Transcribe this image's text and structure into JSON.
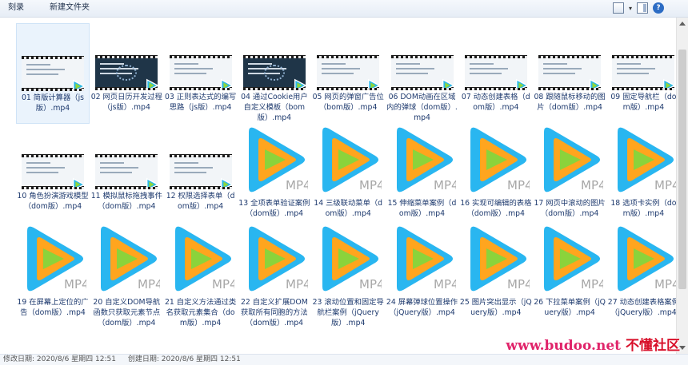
{
  "toolbar": {
    "burn_label": "刻录",
    "new_folder_label": "新建文件夹",
    "dropdown_arrow": "▾",
    "help_glyph": "?"
  },
  "files": [
    {
      "name": "01 简版计算器（js版）.mp4",
      "kind": "video",
      "theme": "light",
      "selected": true
    },
    {
      "name": "02 网页日历开发过程（js版）.mp4",
      "kind": "video",
      "theme": "dark"
    },
    {
      "name": "03 正则表达式的编写思路（js版）.mp4",
      "kind": "video",
      "theme": "light"
    },
    {
      "name": "04 通过Cookie用户自定义模板（bom版）.mp4",
      "kind": "video",
      "theme": "dark"
    },
    {
      "name": "05 网页的弹窗广告位（bom版）.mp4",
      "kind": "video",
      "theme": "light"
    },
    {
      "name": "06 DOM动画在区域内的弹球（dom版）.mp4",
      "kind": "video",
      "theme": "light"
    },
    {
      "name": "07 动态创建表格（dom版）.mp4",
      "kind": "video",
      "theme": "light"
    },
    {
      "name": "08 跟随鼠标移动的图片（dom版）.mp4",
      "kind": "video",
      "theme": "light"
    },
    {
      "name": "09 固定导航栏（dom版）.mp4",
      "kind": "video",
      "theme": "light"
    },
    {
      "name": "10 角色扮演游戏模型（dom版）.mp4",
      "kind": "video",
      "theme": "light"
    },
    {
      "name": "11 模拟鼠标拖拽事件（dom版）.mp4",
      "kind": "video",
      "theme": "light"
    },
    {
      "name": "12 权限选择表单（dom版）.mp4",
      "kind": "video",
      "theme": "light"
    },
    {
      "name": "13 全项表单验证案例（dom版）.mp4",
      "kind": "mp4"
    },
    {
      "name": "14 三级联动菜单（dom版）.mp4",
      "kind": "mp4"
    },
    {
      "name": "15 伸缩菜单案例（dom版）.mp4",
      "kind": "mp4"
    },
    {
      "name": "16 实现可编辑的表格（dom版）.mp4",
      "kind": "mp4"
    },
    {
      "name": "17 网页中滚动的图片（dom版）.mp4",
      "kind": "mp4"
    },
    {
      "name": "18 选项卡实例（dom版）.mp4",
      "kind": "mp4"
    },
    {
      "name": "19 在屏幕上定位的广告（dom版）.mp4",
      "kind": "mp4"
    },
    {
      "name": "20 自定义DOM导航函数只获取元素节点（dom版）.mp4",
      "kind": "mp4"
    },
    {
      "name": "21 自定义方法通过类名获取元素集合（dom版）.mp4",
      "kind": "mp4"
    },
    {
      "name": "22 自定义扩展DOM获取所有同胞的方法（dom版）.mp4",
      "kind": "mp4"
    },
    {
      "name": "23 滚动位置和固定导航栏案例（jQuery版）.mp4",
      "kind": "mp4"
    },
    {
      "name": "24 屏幕弹球位置操作（jQuery版）.mp4",
      "kind": "mp4"
    },
    {
      "name": "25 图片突出显示（jQuery版）.mp4",
      "kind": "mp4"
    },
    {
      "name": "26 下拉菜单案例（jQuery版）.mp4",
      "kind": "mp4"
    },
    {
      "name": "27 动态创建表格案例（jQuery版）.mp4",
      "kind": "mp4"
    }
  ],
  "mp4_badge": "MP4",
  "status": {
    "modified": "修改日期: 2020/8/6 星期四 12:51",
    "created": "创建日期: 2020/8/6 星期四 12:51"
  },
  "watermark": {
    "latin": "www.budoo.net",
    "cn": "不懂社区"
  },
  "colors": {
    "selection": "#eaf3fc",
    "link_text": "#1e3a6e",
    "watermark": "#e0246a"
  }
}
